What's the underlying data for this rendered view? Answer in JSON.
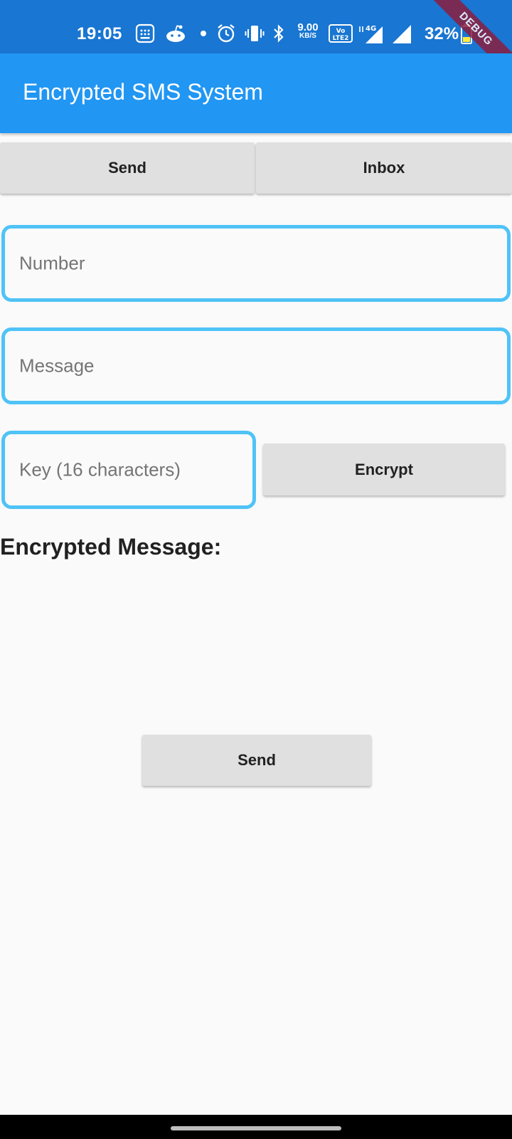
{
  "status_bar": {
    "time": "19:05",
    "network_speed_value": "9.00",
    "network_speed_unit": "KB/S",
    "volte_label": "VoLTE 2",
    "network_type": "4G",
    "battery_percent": "32%",
    "icons": [
      "calculator-icon",
      "reddit-icon",
      "dot-icon",
      "alarm-icon",
      "vibrate-icon",
      "bluetooth-icon",
      "network-speed-icon",
      "volte-icon",
      "signal-4g-icon",
      "signal-icon",
      "battery-icon"
    ]
  },
  "debug_banner": "DEBUG",
  "app_bar": {
    "title": "Encrypted SMS System",
    "color": "#2196f3"
  },
  "tabs": [
    {
      "label": "Send"
    },
    {
      "label": "Inbox"
    }
  ],
  "form": {
    "number_placeholder": "Number",
    "message_placeholder": "Message",
    "key_placeholder": "Key (16 characters)",
    "encrypt_label": "Encrypt",
    "field_border_color": "#4fc3f7"
  },
  "encrypted": {
    "heading": "Encrypted Message:",
    "value": ""
  },
  "send_button": {
    "label": "Send"
  }
}
